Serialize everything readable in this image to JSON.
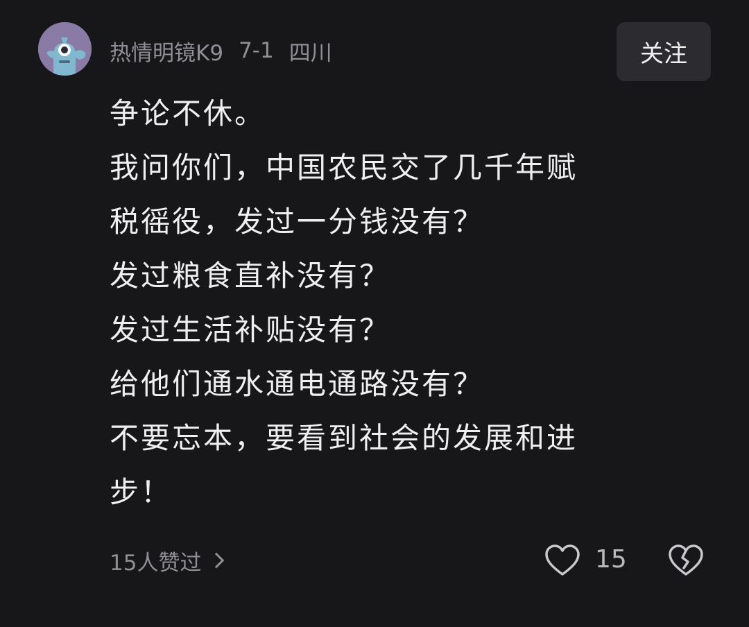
{
  "comment": {
    "user_name": "热情明镜K9",
    "date": "7-1",
    "location": "四川",
    "follow_label": "关注",
    "body_lines": [
      "争论不休。",
      "我问你们，中国农民交了几千年赋",
      "税徭役，发过一分钱没有？",
      "发过粮食直补没有？",
      "发过生活补贴没有？",
      "给他们通水通电通路没有？",
      "不要忘本，要看到社会的发展和进",
      "步！"
    ],
    "likes_summary": "15人赞过",
    "like_count": "15",
    "icons": {
      "avatar": "avatar-monster-icon",
      "like": "heart-outline-icon",
      "dislike": "broken-heart-icon",
      "more": "chevron-right-icon"
    }
  },
  "colors": {
    "background": "#17171a",
    "text": "#efefef",
    "muted_text": "#8f8f94",
    "button_bg": "#2c2c30"
  }
}
